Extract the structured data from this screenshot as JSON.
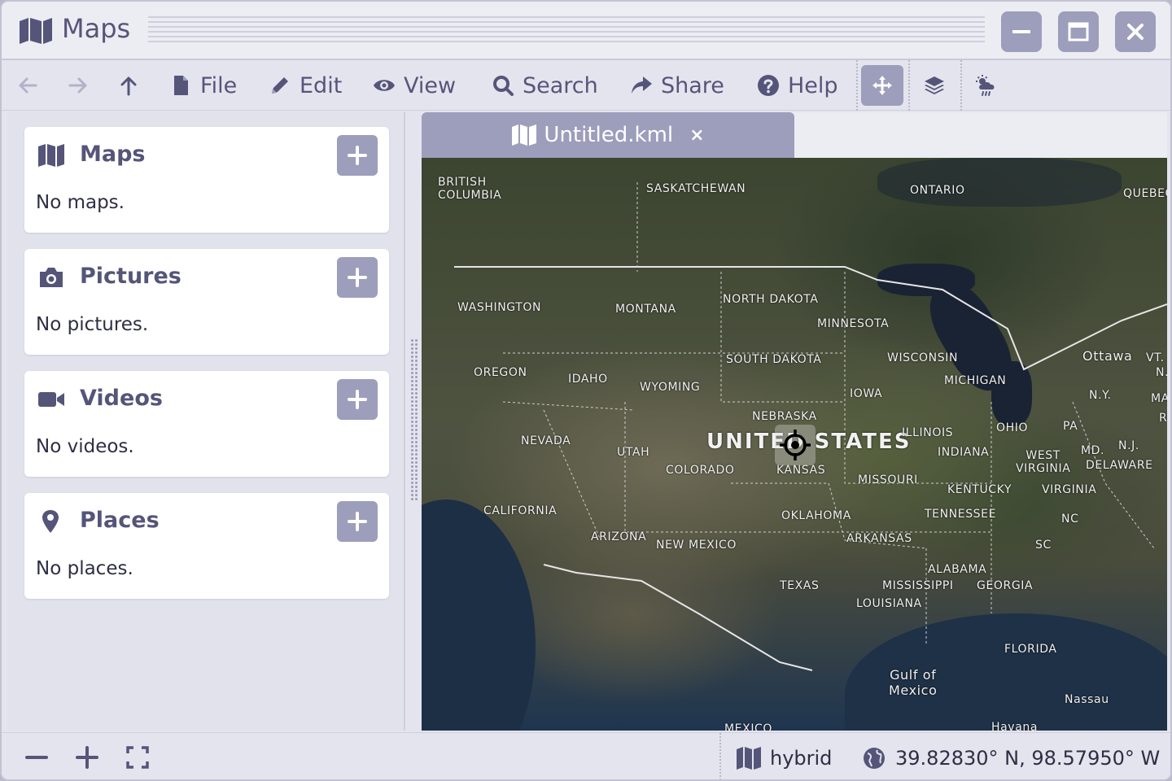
{
  "app": {
    "title": "Maps"
  },
  "toolbar": {
    "file_label": "File",
    "edit_label": "Edit",
    "view_label": "View",
    "search_label": "Search",
    "share_label": "Share",
    "help_label": "Help"
  },
  "sidebar": {
    "cards": [
      {
        "title": "Maps",
        "empty_text": "No maps.",
        "icon": "map-icon"
      },
      {
        "title": "Pictures",
        "empty_text": "No pictures.",
        "icon": "camera-icon"
      },
      {
        "title": "Videos",
        "empty_text": "No videos.",
        "icon": "video-icon"
      },
      {
        "title": "Places",
        "empty_text": "No places.",
        "icon": "map-pin-icon"
      }
    ]
  },
  "tab": {
    "label": "Untitled.kml",
    "close": "×"
  },
  "map": {
    "labels": {
      "british_columbia": "BRITISH\nCOLUMBIA",
      "saskatchewan": "SASKATCHEWAN",
      "ontario": "ONTARIO",
      "quebec": "QUEBEC",
      "washington": "WASHINGTON",
      "montana": "MONTANA",
      "north_dakota": "NORTH DAKOTA",
      "minnesota": "MINNESOTA",
      "oregon": "OREGON",
      "idaho": "IDAHO",
      "wyoming": "WYOMING",
      "south_dakota": "SOUTH DAKOTA",
      "wisconsin": "WISCONSIN",
      "michigan": "MICHIGAN",
      "ottawa": "Ottawa",
      "nebraska": "NEBRASKA",
      "iowa": "IOWA",
      "nevada": "NEVADA",
      "utah": "UTAH",
      "united_states": "UNITED STATES",
      "illinois": "ILLINOIS",
      "ohio": "OHIO",
      "pa": "PA",
      "ny": "N.Y.",
      "colorado": "COLORADO",
      "kansas": "KANSAS",
      "missouri": "MISSOURI",
      "indiana": "INDIANA",
      "west_virginia": "WEST\nVIRGINIA",
      "md": "MD.",
      "nj": "N.J.",
      "delaware": "DELAWARE",
      "california": "CALIFORNIA",
      "kentucky": "KENTUCKY",
      "virginia": "VIRGINIA",
      "oklahoma": "OKLAHOMA",
      "tennessee": "TENNESSEE",
      "nc": "NC",
      "arizona": "ARIZONA",
      "new_mexico": "NEW MEXICO",
      "arkansas": "ARKANSAS",
      "sc": "SC",
      "alabama": "ALABAMA",
      "texas": "TEXAS",
      "mississippi": "MISSISSIPPI",
      "georgia": "GEORGIA",
      "louisiana": "LOUISIANA",
      "florida": "FLORIDA",
      "gulf": "Gulf of\nMexico",
      "nassau": "Nassau",
      "havana": "Havana",
      "mexico": "MEXICO",
      "vt": "VT.",
      "nh": "N.",
      "mass": "MASS",
      "ri": "R"
    }
  },
  "status": {
    "map_type": "hybrid",
    "coordinates": "39.82830° N,  98.57950° W"
  },
  "colors": {
    "accent": "#9d9dbc",
    "icon": "#55557a",
    "background": "#e4e4ee"
  }
}
